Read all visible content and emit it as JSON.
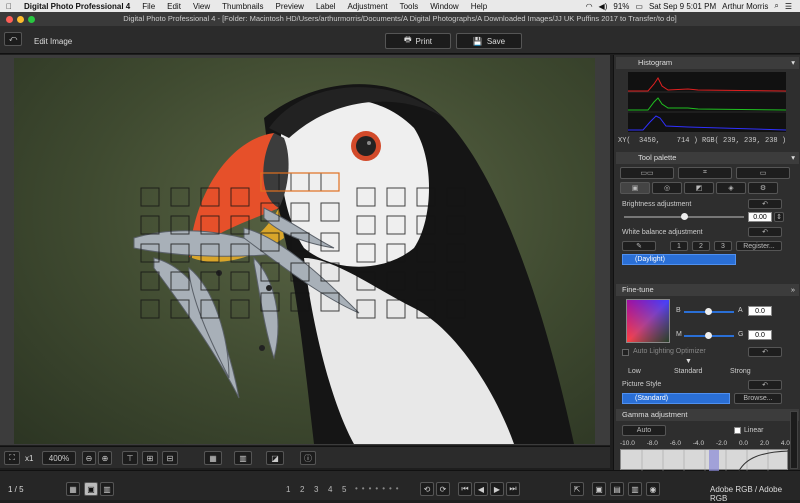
{
  "menubar": {
    "apple": "",
    "app_name": "Digital Photo Professional 4",
    "items": [
      "File",
      "Edit",
      "View",
      "Thumbnails",
      "Preview",
      "Label",
      "Adjustment",
      "Tools",
      "Window",
      "Help"
    ],
    "battery": "91%",
    "datetime": "Sat Sep 9  5:01 PM",
    "user": "Arthur Morris"
  },
  "window": {
    "title": "Digital Photo Professional 4 - [Folder: Macintosh HD/Users/arthurmorris/Documents/A Digital Photographs/A Downloaded Images/JJ UK Puffins 2017 to Transfer/to do]"
  },
  "toolbar": {
    "edit_image_label": "Edit Image",
    "print_label": "Print",
    "save_label": "Save"
  },
  "bottombar": {
    "zoom_x": "x1",
    "zoom_value": "400%"
  },
  "statusbar": {
    "page": "1 / 5",
    "ratings": [
      "1",
      "2",
      "3",
      "4",
      "5"
    ],
    "color_space": "Adobe RGB / Adobe RGB"
  },
  "histogram": {
    "title": "Histogram",
    "readout": "XY(  3450,    714 ) RGB( 239, 239, 238 )"
  },
  "tool_palette": {
    "title": "Tool palette",
    "brightness_label": "Brightness adjustment",
    "brightness_value": "0.00",
    "brightness_level": 0.5,
    "wb_label": "White balance adjustment",
    "wb_presets": [
      "1",
      "2",
      "3"
    ],
    "register_label": "Register...",
    "wb_value": "(Daylight)"
  },
  "finetune": {
    "title": "Fine-tune",
    "b_label": "B",
    "a_label": "A",
    "a_value": "0.0",
    "m_label": "M",
    "g_label": "G",
    "g_value": "0.0",
    "alo_label": "Auto Lighting Optimizer",
    "alo_low": "Low",
    "alo_standard": "Standard",
    "alo_strong": "Strong",
    "picture_style_label": "Picture Style",
    "picture_style_value": "(Standard)",
    "browse_label": "Browse..."
  },
  "gamma": {
    "title": "Gamma adjustment",
    "auto_label": "Auto",
    "linear_label": "Linear",
    "scale": [
      "-10.0",
      "-8.0",
      "-6.0",
      "-4.0",
      "-2.0",
      "0.0",
      "2.0",
      "4.0"
    ]
  },
  "colors": {
    "selection_blue": "#2a6fd6",
    "histogram_red": "#e02020",
    "histogram_green": "#20c020",
    "histogram_blue": "#3030ff"
  }
}
